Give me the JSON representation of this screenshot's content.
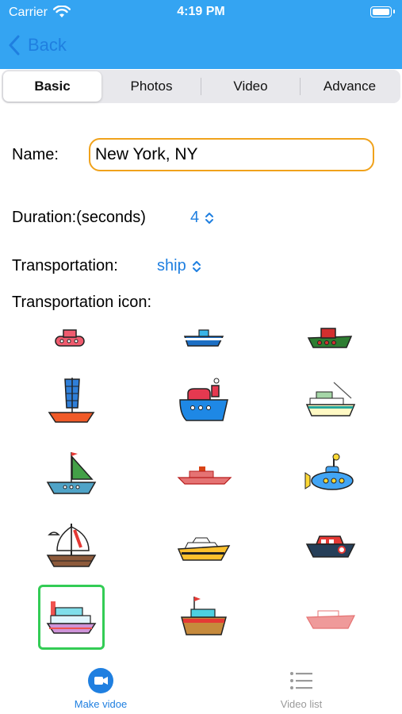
{
  "status_bar": {
    "carrier": "Carrier",
    "time": "4:19 PM"
  },
  "nav": {
    "back_label": "Back"
  },
  "segments": [
    {
      "label": "Basic",
      "active": true
    },
    {
      "label": "Photos",
      "active": false
    },
    {
      "label": "Video",
      "active": false
    },
    {
      "label": "Advance",
      "active": false
    }
  ],
  "form": {
    "name_label": "Name:",
    "name_value": "New York, NY",
    "duration_label": "Duration:(seconds)",
    "duration_value": "4",
    "transportation_label": "Transportation:",
    "transportation_value": "ship",
    "icon_label": "Transportation icon:"
  },
  "icons": [
    {
      "name": "boat-red-icon",
      "selected": false
    },
    {
      "name": "ship-blue-icon",
      "selected": false
    },
    {
      "name": "tugboat-red-green-icon",
      "selected": false
    },
    {
      "name": "junk-sailboat-icon",
      "selected": false
    },
    {
      "name": "steamship-icon",
      "selected": false
    },
    {
      "name": "ferry-icon",
      "selected": false
    },
    {
      "name": "sailboat-green-icon",
      "selected": false
    },
    {
      "name": "cruise-ship-red-icon",
      "selected": false
    },
    {
      "name": "submarine-icon",
      "selected": false
    },
    {
      "name": "pirate-sailboat-icon",
      "selected": false
    },
    {
      "name": "cruise-liner-yellow-icon",
      "selected": false
    },
    {
      "name": "speedboat-icon",
      "selected": false
    },
    {
      "name": "yacht-pink-icon",
      "selected": true
    },
    {
      "name": "fishing-boat-icon",
      "selected": false
    },
    {
      "name": "motorboat-white-icon",
      "selected": false
    }
  ],
  "tabbar": {
    "make_video_label": "Make vidoe",
    "video_list_label": "Video list",
    "active_color": "#1f7fe0",
    "inactive_color": "#9a9a9a"
  },
  "colors": {
    "header": "#34a4f2",
    "accent": "#1f7fe0",
    "input_border": "#f0a21b",
    "selected_border": "#33cc55"
  }
}
